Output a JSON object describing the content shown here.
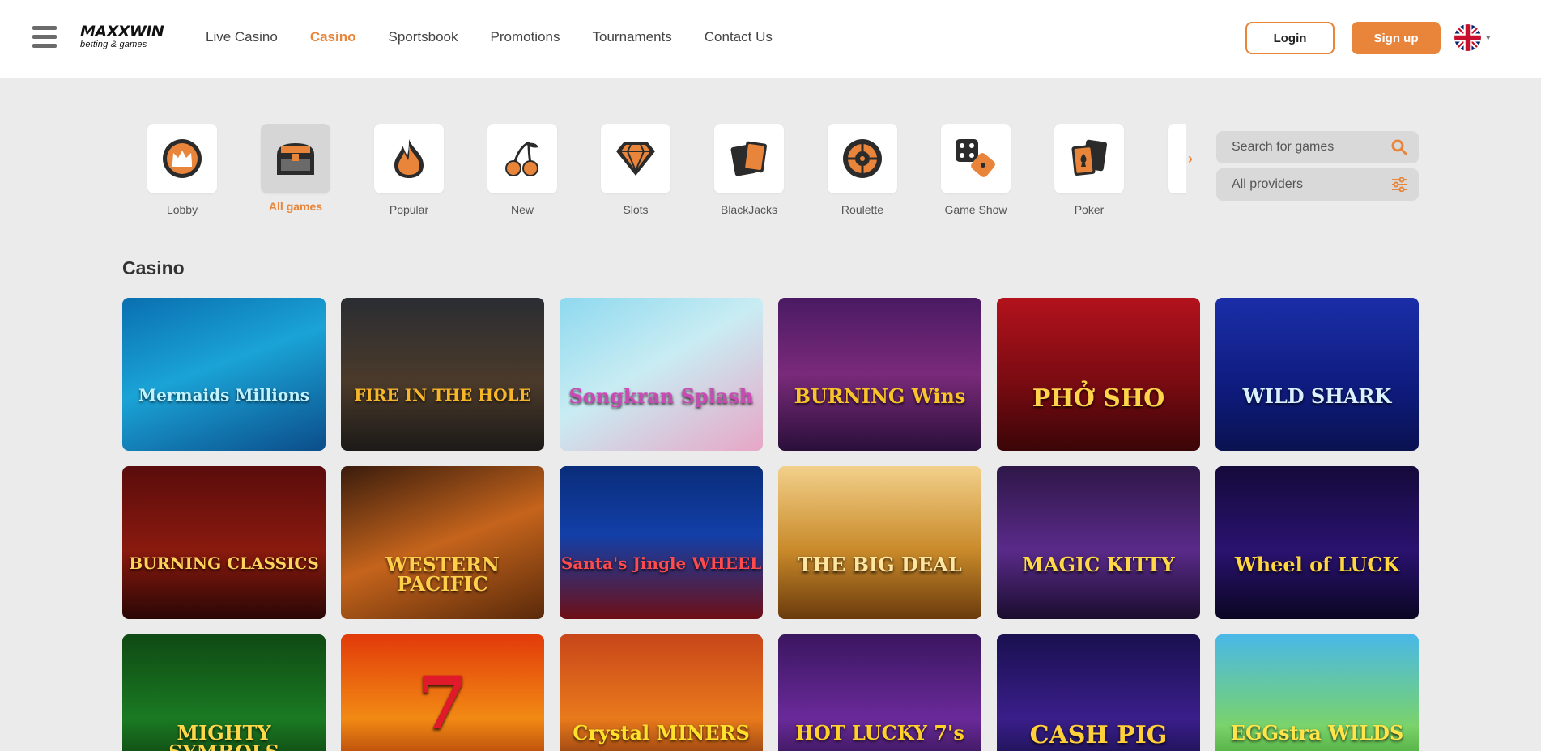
{
  "header": {
    "logo_main": "MAXXWIN",
    "logo_sub": "betting & games",
    "nav": [
      {
        "label": "Live Casino",
        "active": false
      },
      {
        "label": "Casino",
        "active": true
      },
      {
        "label": "Sportsbook",
        "active": false
      },
      {
        "label": "Promotions",
        "active": false
      },
      {
        "label": "Tournaments",
        "active": false
      },
      {
        "label": "Contact Us",
        "active": false
      }
    ],
    "login_label": "Login",
    "signup_label": "Sign up",
    "language_icon": "uk-flag-icon"
  },
  "categories": [
    {
      "label": "Lobby",
      "icon": "crown-icon",
      "active": false
    },
    {
      "label": "All games",
      "icon": "chest-icon",
      "active": true
    },
    {
      "label": "Popular",
      "icon": "flame-icon",
      "active": false
    },
    {
      "label": "New",
      "icon": "cherries-icon",
      "active": false
    },
    {
      "label": "Slots",
      "icon": "diamond-icon",
      "active": false
    },
    {
      "label": "BlackJacks",
      "icon": "cards-icon",
      "active": false
    },
    {
      "label": "Roulette",
      "icon": "roulette-icon",
      "active": false
    },
    {
      "label": "Game Show",
      "icon": "dice-icon",
      "active": false
    },
    {
      "label": "Poker",
      "icon": "poker-cards-icon",
      "active": false
    }
  ],
  "search": {
    "placeholder": "Search for games"
  },
  "providers": {
    "label": "All providers"
  },
  "section_title": "Casino",
  "games": [
    {
      "title": "Mermaids Millions",
      "bg": "linear-gradient(160deg,#0a6fb0 0%,#1aa3d6 45%,#0b4d8a 100%)",
      "color": "#bff3ff"
    },
    {
      "title": "FIRE IN THE HOLE",
      "bg": "linear-gradient(180deg,#2a2d33 0%,#4b3a2a 55%,#1c1a18 100%)",
      "color": "#f7b52a"
    },
    {
      "title": "Songkran Splash",
      "bg": "linear-gradient(150deg,#8ed9ef 0%,#c9ecf3 45%,#e7a6c6 100%)",
      "color": "#c94ab5"
    },
    {
      "title": "BURNING Wins",
      "bg": "linear-gradient(180deg,#4a1a63 0%,#7a2a7a 50%,#2a0f3a 100%)",
      "color": "#f9c32a"
    },
    {
      "title": "PHỞ SHO",
      "bg": "linear-gradient(180deg,#b3121c 0%,#7a0b12 55%,#3a0507 100%)",
      "color": "#ffd34a"
    },
    {
      "title": "WILD SHARK",
      "bg": "linear-gradient(180deg,#1b2ea8 0%,#0e1b7d 60%,#0a1250 100%)",
      "color": "#d9f0ff"
    },
    {
      "title": "BURNING CLASSICS",
      "bg": "linear-gradient(180deg,#5a0c0c 0%,#8a1a0e 55%,#2a0605 100%)",
      "color": "#ffd25a"
    },
    {
      "title": "WESTERN PACIFIC",
      "bg": "linear-gradient(160deg,#3a1c0c 0%,#c5641c 50%,#5a2a0a 100%)",
      "color": "#ffce4a"
    },
    {
      "title": "Santa's Jingle WHEEL",
      "bg": "linear-gradient(180deg,#0a2d7a 0%,#123fa8 45%,#6e0f16 100%)",
      "color": "#ff4b4b"
    },
    {
      "title": "THE BIG DEAL",
      "bg": "linear-gradient(180deg,#f2d08a 0%,#c98a2a 55%,#6a3a0c 100%)",
      "color": "#ffe6a0"
    },
    {
      "title": "MAGIC KITTY",
      "bg": "linear-gradient(180deg,#2e1748 0%,#5a2a8a 55%,#1a0d2e 100%)",
      "color": "#ffd84a"
    },
    {
      "title": "Wheel of LUCK",
      "bg": "linear-gradient(180deg,#150a3a 0%,#2a1270 55%,#0a0622 100%)",
      "color": "#ffd640"
    },
    {
      "title": "MIGHTY SYMBOLS",
      "bg": "linear-gradient(180deg,#0f4a14 0%,#1a7a22 55%,#0a2a0c 100%)",
      "color": "#ffd84a"
    },
    {
      "title": "7",
      "bg": "linear-gradient(180deg,#e23a0a 0%,#f28a14 55%,#8a1a05 100%)",
      "color": "#e01a2a"
    },
    {
      "title": "Crystal MINERS",
      "bg": "linear-gradient(180deg,#c8461a 0%,#e97a1c 55%,#5a1a0a 100%)",
      "color": "#ffe02a"
    },
    {
      "title": "HOT LUCKY 7's",
      "bg": "linear-gradient(180deg,#3a1660 0%,#6a2a9a 55%,#1a0a30 100%)",
      "color": "#ffcf2a"
    },
    {
      "title": "CASH PIG",
      "bg": "linear-gradient(180deg,#1a1050 0%,#3a1e8a 55%,#0a0a30 100%)",
      "color": "#ffd03a"
    },
    {
      "title": "EGGstra WILDS",
      "bg": "linear-gradient(180deg,#4ab8e8 0%,#7ad36a 60%,#2a8a1a 100%)",
      "color": "#ffe44a"
    }
  ]
}
